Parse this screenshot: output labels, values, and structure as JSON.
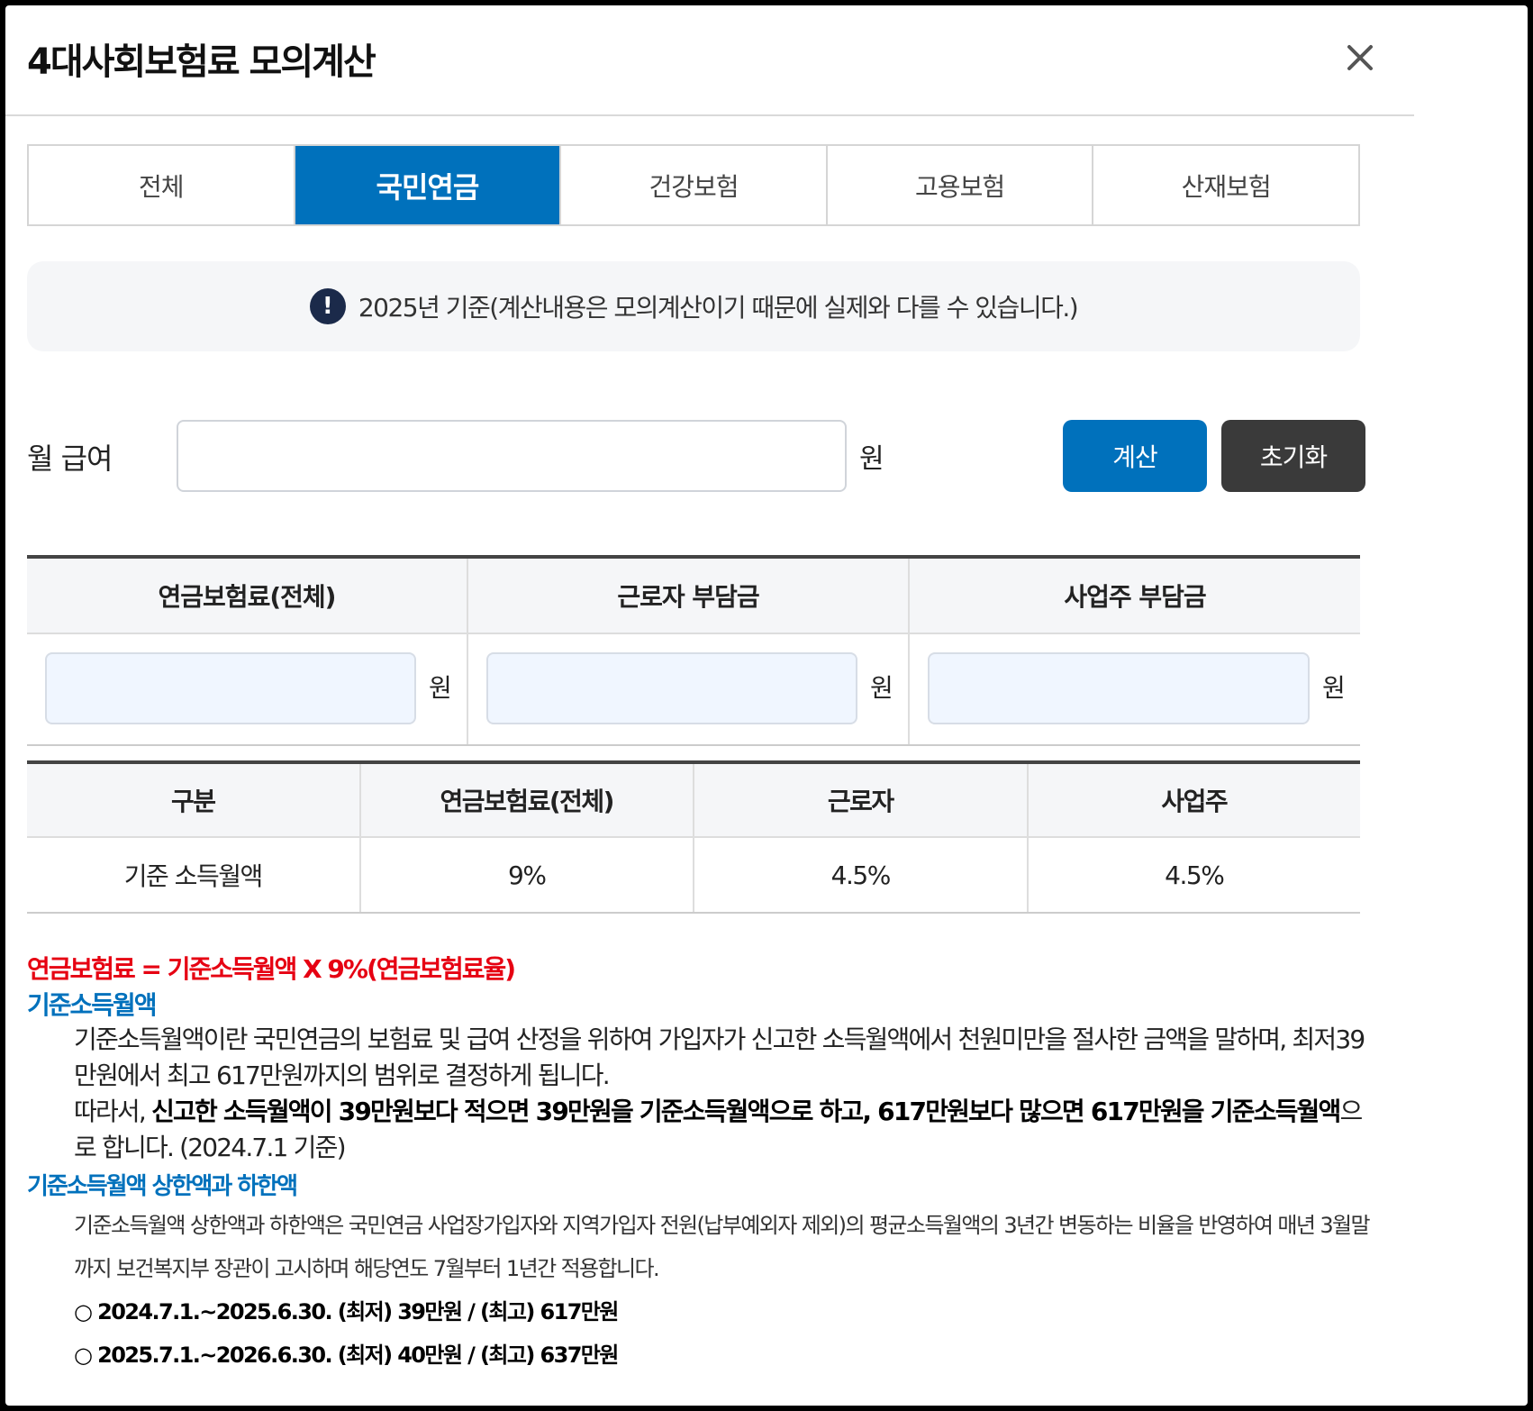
{
  "header": {
    "title": "4대사회보험료 모의계산",
    "close_icon": "close-icon"
  },
  "tabs": [
    {
      "label": "전체",
      "active": false
    },
    {
      "label": "국민연금",
      "active": true
    },
    {
      "label": "건강보험",
      "active": false
    },
    {
      "label": "고용보험",
      "active": false
    },
    {
      "label": "산재보험",
      "active": false
    }
  ],
  "notice": {
    "icon": "exclamation-icon",
    "text": "2025년 기준(계산내용은 모의계산이기 때문에 실제와 다를 수 있습니다.)"
  },
  "salary": {
    "label": "월 급여",
    "value": "",
    "unit": "원",
    "calc_label": "계산",
    "reset_label": "초기화"
  },
  "result": {
    "headers": [
      "연금보험료(전체)",
      "근로자 부담금",
      "사업주 부담금"
    ],
    "unit": "원",
    "values": [
      "",
      "",
      ""
    ]
  },
  "rates": {
    "headers": [
      "구분",
      "연금보험료(전체)",
      "근로자",
      "사업주"
    ],
    "row": [
      "기준 소득월액",
      "9%",
      "4.5%",
      "4.5%"
    ]
  },
  "description": {
    "formula": "연금보험료 = 기준소득월액 X 9%(연금보험료율)",
    "section1_title": "기준소득월액",
    "section1_para1": "기준소득월액이란 국민연금의 보험료 및 급여 산정을 위하여 가입자가 신고한 소득월액에서 천원미만을 절사한 금액을 말하며, 최저39만원에서 최고 617만원까지의 범위로 결정하게 됩니다.",
    "section1_para2_prefix": "따라서, ",
    "section1_para2_bold": "신고한 소득월액이 39만원보다 적으면 39만원을 기준소득월액으로 하고, 617만원보다 많으면 617만원을 기준소득월액",
    "section1_para2_suffix": "으로 합니다. (2024.7.1 기준)",
    "section2_title": "기준소득월액 상한액과 하한액",
    "section2_para": "기준소득월액 상한액과 하한액은 국민연금 사업장가입자와 지역가입자 전원(납부예외자 제외)의 평균소득월액의 3년간 변동하는 비율을 반영하여 매년 3월말까지 보건복지부 장관이 고시하며 해당연도 7월부터 1년간 적용합니다.",
    "range1": "○ 2024.7.1.~2025.6.30. (최저) 39만원 / (최고) 617만원",
    "range2": "○ 2025.7.1.~2026.6.30. (최저) 40만원 / (최고) 637만원"
  }
}
